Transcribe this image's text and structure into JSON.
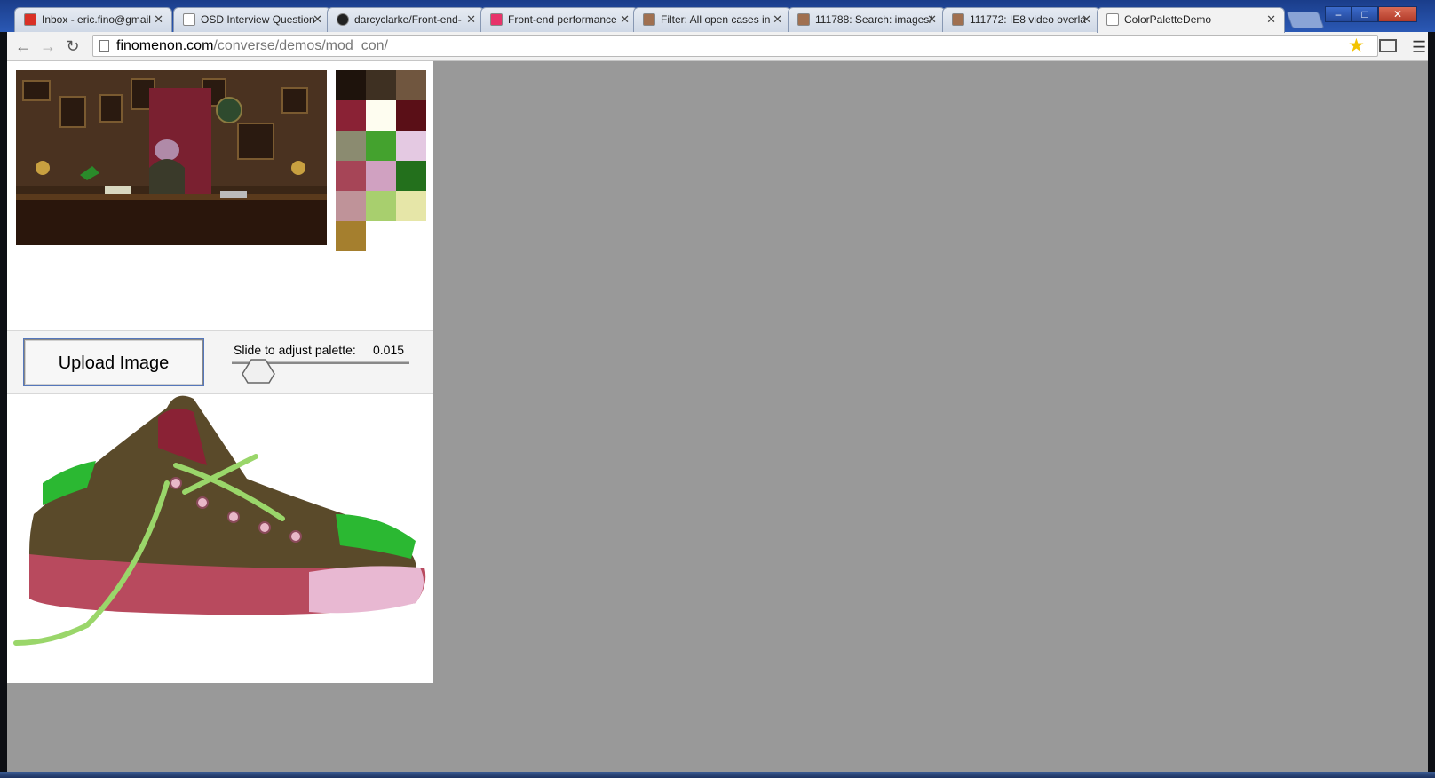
{
  "tabs": [
    {
      "title": "Inbox - eric.fino@gmail",
      "icon": "gmail-icon",
      "active": false
    },
    {
      "title": "OSD Interview Question",
      "icon": "page-icon",
      "active": false
    },
    {
      "title": "darcyclarke/Front-end-",
      "icon": "github-icon",
      "active": false
    },
    {
      "title": "Front-end performance",
      "icon": "css-icon",
      "active": false
    },
    {
      "title": "Filter: All open cases in",
      "icon": "fogbugz-icon",
      "active": false
    },
    {
      "title": "111788: Search: images/",
      "icon": "fogbugz-icon",
      "active": false
    },
    {
      "title": "111772: IE8 video overla",
      "icon": "fogbugz-icon",
      "active": false
    },
    {
      "title": "ColorPaletteDemo",
      "icon": "page-icon",
      "active": true
    }
  ],
  "address": {
    "domain": "finomenon.com",
    "path": "/converse/demos/mod_con/"
  },
  "controls": {
    "upload_label": "Upload Image",
    "slider_label": "Slide to adjust palette:",
    "slider_value": "0.015",
    "slider_fraction": 0.15
  },
  "palette": [
    "#1e130c",
    "#3e3022",
    "#70563f",
    "#8a2235",
    "#fefdf0",
    "#5a0f17",
    "#8b8b70",
    "#44a22e",
    "#e4c9e2",
    "#a64557",
    "#d0a1c1",
    "#23701c",
    "#bf9399",
    "#a8cf6e",
    "#e6e6a8",
    "#a57f2e"
  ],
  "colors": {
    "viewport_bg": "#999999",
    "tabstrip": "#2b59b5"
  }
}
